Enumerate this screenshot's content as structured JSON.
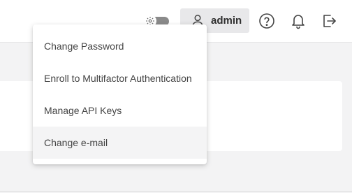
{
  "header": {
    "user_label": "admin"
  },
  "user_menu": {
    "items": [
      {
        "label": "Change Password"
      },
      {
        "label": "Enroll to Multifactor Authentication"
      },
      {
        "label": "Manage API Keys"
      },
      {
        "label": "Change e-mail"
      }
    ]
  },
  "icons": {
    "theme": "gear-icon",
    "user": "user-icon",
    "help": "help-circle-icon",
    "notifications": "bell-icon",
    "logout": "logout-icon"
  },
  "colors": {
    "topbar_bg": "#ffffff",
    "page_bg": "#f3f3f4",
    "user_button_bg": "#e8e8ea",
    "hovered_item_bg": "#f4f4f5",
    "icon": "#444444"
  }
}
